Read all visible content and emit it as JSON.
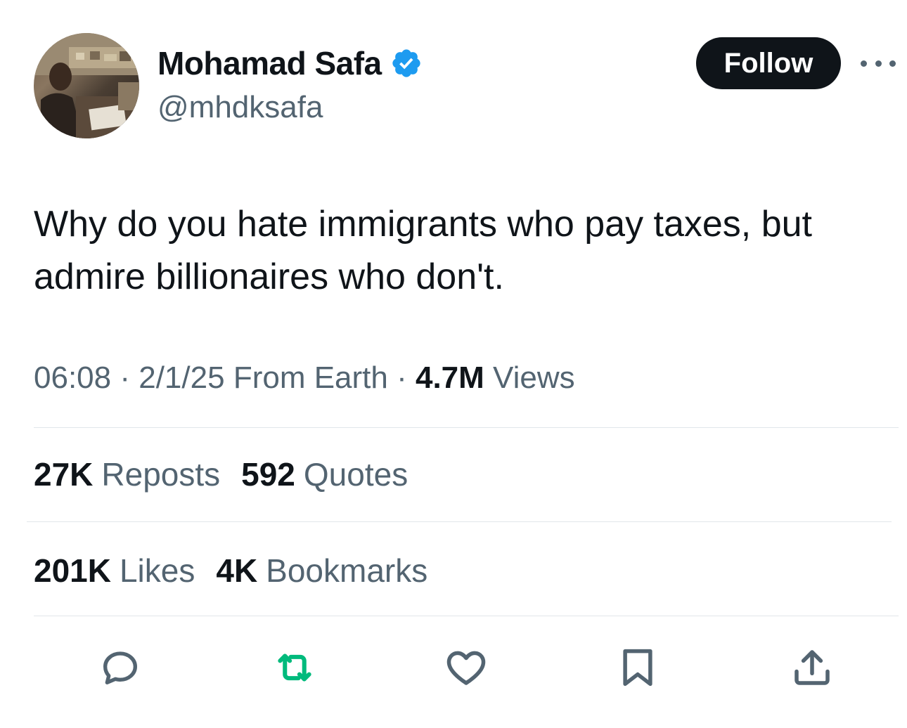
{
  "author": {
    "display_name": "Mohamad Safa",
    "handle": "@mhdksafa",
    "verified": true
  },
  "follow_button": {
    "label": "Follow"
  },
  "tweet": {
    "text": "Why do you hate immigrants who pay taxes, but admire billionaires who don't."
  },
  "meta": {
    "time": "06:08",
    "separator": "·",
    "date": "2/1/25",
    "source": "From Earth",
    "views_count": "4.7M",
    "views_label": "Views"
  },
  "stats": {
    "reposts": {
      "count": "27K",
      "label": "Reposts"
    },
    "quotes": {
      "count": "592",
      "label": "Quotes"
    },
    "likes": {
      "count": "201K",
      "label": "Likes"
    },
    "bookmarks": {
      "count": "4K",
      "label": "Bookmarks"
    }
  },
  "actions": [
    "reply-icon",
    "repost-icon",
    "like-icon",
    "bookmark-icon",
    "share-icon"
  ],
  "colors": {
    "text_primary": "#0f1419",
    "text_secondary": "#536471",
    "verified_blue": "#1d9bf0",
    "repost_green": "#00ba7c",
    "divider": "#e1e6ea"
  }
}
